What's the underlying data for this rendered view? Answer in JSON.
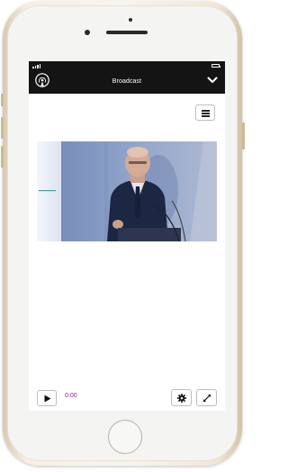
{
  "header": {
    "title": "Broadcast",
    "icon": "broadcast-icon",
    "collapse_icon": "chevron-down-icon"
  },
  "status_bar": {
    "signal_icon": "signal-icon",
    "battery_icon": "battery-icon"
  },
  "menu": {
    "icon": "hamburger-menu-icon"
  },
  "player": {
    "elapsed_time": "0:00",
    "play_icon": "play-icon",
    "settings_icon": "gear-icon",
    "fullscreen_icon": "expand-icon"
  },
  "colors": {
    "topbar_bg": "#141414",
    "time_text": "#7a2a8a",
    "phone_frame": "#f2ebe0"
  }
}
